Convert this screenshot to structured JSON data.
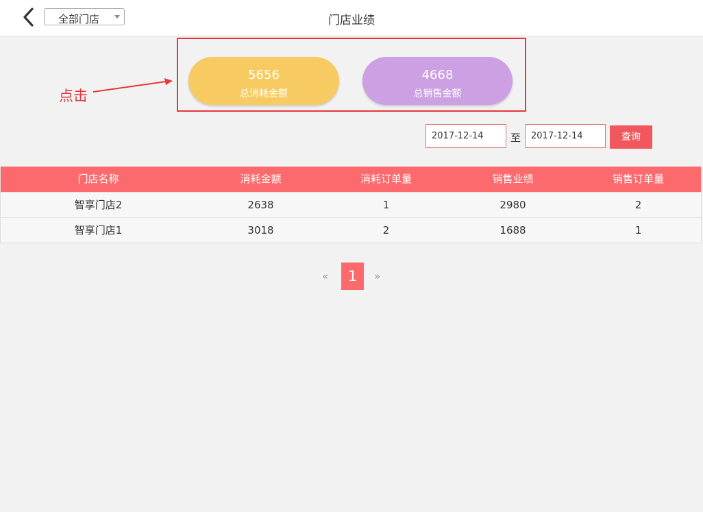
{
  "header": {
    "title": "门店业绩",
    "store_select": "全部门店"
  },
  "summary": {
    "consume_value": "5656",
    "consume_label": "总消耗金额",
    "sales_value": "4668",
    "sales_label": "总销售金额"
  },
  "annotation": {
    "text": "点击"
  },
  "filter": {
    "start_date": "2017-12-14",
    "separator": "至",
    "end_date": "2017-12-14",
    "query_label": "查询"
  },
  "table": {
    "columns": [
      "门店名称",
      "消耗金额",
      "消耗订单量",
      "销售业绩",
      "销售订单量"
    ],
    "rows": [
      [
        "智享门店2",
        "2638",
        "1",
        "2980",
        "2"
      ],
      [
        "智享门店1",
        "3018",
        "2",
        "1688",
        "1"
      ]
    ]
  },
  "pagination": {
    "prev": "«",
    "current": "1",
    "next": "»"
  },
  "colors": {
    "accent": "#fd6a6d",
    "consume_pill": "#f7cb62",
    "sales_pill": "#cca0e3",
    "annotation": "#e8363a"
  }
}
